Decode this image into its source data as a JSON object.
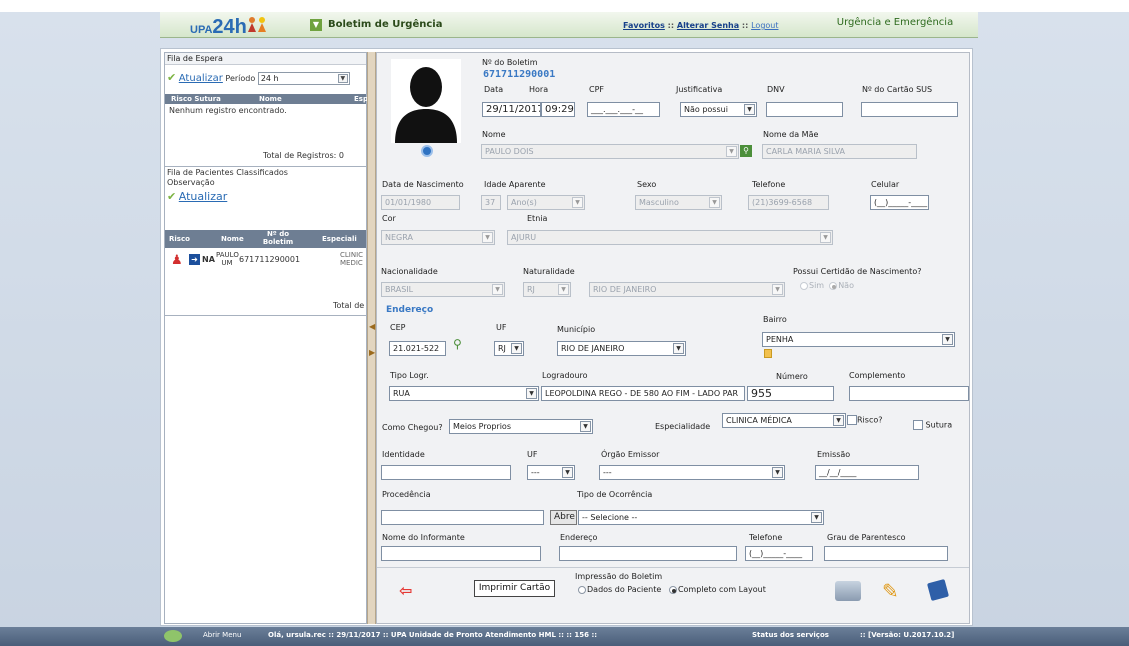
{
  "header": {
    "logo_small": "UPA",
    "logo_big": "24h",
    "title": "Boletim de Urgência",
    "link_favoritos": "Favoritos",
    "link_alterar_senha": "Alterar Senha",
    "link_logout": "Logout",
    "separator": "::",
    "right_label": "Urgência e Emergência"
  },
  "left": {
    "fila_espera_title": "Fila de Espera",
    "atualizar_label": "Atualizar",
    "periodo_label": "Período",
    "periodo_value": "24 h",
    "table1_headers": [
      "Risco Sutura",
      "Nome",
      "Esp"
    ],
    "empty_message": "Nenhum registro encontrado.",
    "total_registros": "Total de Registros: 0",
    "fila_classificados_title": "Fila de Pacientes Classificados",
    "observacao_label": "Observação",
    "atualizar2_label": "Atualizar",
    "table2_headers": [
      "Risco",
      "Nome",
      "Nº do Boletim",
      "Especiali"
    ],
    "row": {
      "badge": "NA",
      "nome1": "PAULO",
      "nome2": "UM",
      "boletim": "671711290001",
      "esp1": "CLINIC",
      "esp2": "MEDIC"
    },
    "total_de": "Total de"
  },
  "form": {
    "boletim_label": "Nº do Boletim",
    "boletim_number": "671711290001",
    "data_label": "Data",
    "data_value": "29/11/2017",
    "hora_label": "Hora",
    "hora_value": "09:29",
    "cpf_label": "CPF",
    "cpf_value": "___.___.___-__",
    "justificativa_label": "Justificativa",
    "justificativa_value": "Não possui",
    "dnv_label": "DNV",
    "dnv_value": "",
    "cartao_sus_label": "Nº do Cartão SUS",
    "cartao_sus_value": "",
    "nome_label": "Nome",
    "nome_value": "PAULO DOIS",
    "nome_mae_label": "Nome da Mãe",
    "nome_mae_value": "CARLA MARIA SILVA",
    "nascimento_label": "Data de Nascimento",
    "nascimento_value": "01/01/1980",
    "idade_label": "Idade Aparente",
    "idade_value": "37",
    "idade_unit": "Ano(s)",
    "sexo_label": "Sexo",
    "sexo_value": "Masculino",
    "telefone_label": "Telefone",
    "telefone_value": "(21)3699-6568",
    "celular_label": "Celular",
    "celular_value": "(__)_____-____",
    "cor_label": "Cor",
    "cor_value": "NEGRA",
    "etnia_label": "Etnia",
    "etnia_value": "AJURU",
    "nacionalidade_label": "Nacionalidade",
    "nacionalidade_value": "BRASIL",
    "naturalidade_label": "Naturalidade",
    "naturalidade_uf": "RJ",
    "naturalidade_cidade": "RIO DE JANEIRO",
    "certidao_label": "Possui Certidão de Nascimento?",
    "certidao_sim": "Sim",
    "certidao_nao": "Não",
    "endereco_title": "Endereço",
    "cep_label": "CEP",
    "cep_value": "21.021-522",
    "uf_label": "UF",
    "uf_value": "RJ",
    "municipio_label": "Município",
    "municipio_value": "RIO DE JANEIRO",
    "bairro_label": "Bairro",
    "bairro_value": "PENHA",
    "tipo_logr_label": "Tipo Logr.",
    "tipo_logr_value": "RUA",
    "logradouro_label": "Logradouro",
    "logradouro_value": "LEOPOLDINA REGO - DE 580 AO FIM - LADO PAR",
    "numero_label": "Número",
    "numero_value": "955",
    "complemento_label": "Complemento",
    "complemento_value": "",
    "como_chegou_label": "Como Chegou?",
    "como_chegou_value": "Meios Proprios",
    "especialidade_label": "Especialidade",
    "especialidade_value": "CLINICA MÉDICA",
    "risco_label": "Risco?",
    "sutura_label": "Sutura",
    "identidade_label": "Identidade",
    "identidade_value": "",
    "uf2_label": "UF",
    "uf2_value": "---",
    "orgao_label": "Órgão Emissor",
    "orgao_value": "---",
    "emissao_label": "Emissão",
    "emissao_value": "__/__/____",
    "procedencia_label": "Procedência",
    "procedencia_value": "",
    "tipo_ocorrencia_label": "Tipo de Ocorrência",
    "abre_label": "Abre",
    "tipo_ocorrencia_value": "-- Selecione --",
    "informante_label": "Nome do Informante",
    "informante_value": "",
    "endereco2_label": "Endereço",
    "endereco2_value": "",
    "telefone2_label": "Telefone",
    "telefone2_value": "(__)_____-____",
    "parentesco_label": "Grau de Parentesco",
    "parentesco_value": "",
    "imprimir_label": "Imprimir Cartão",
    "impressao_label": "Impressão do Boletim",
    "dados_paciente_label": "Dados do Paciente",
    "completo_label": "Completo com Layout"
  },
  "footer": {
    "abrir_menu": "Abrir Menu",
    "status_line": "Olá, ursula.rec  ::  29/11/2017  ::  UPA Unidade de Pronto Atendimento HML  ::    ::  156  ::",
    "status_servicos": "Status dos serviços",
    "versao": "::  [Versão: U.2017.10.2]"
  },
  "colors": {
    "accent": "#2a6bb4",
    "header_green": "#d5e6cb",
    "risk_red": "#d32f2f",
    "badge_blue": "#1c4f9c"
  }
}
